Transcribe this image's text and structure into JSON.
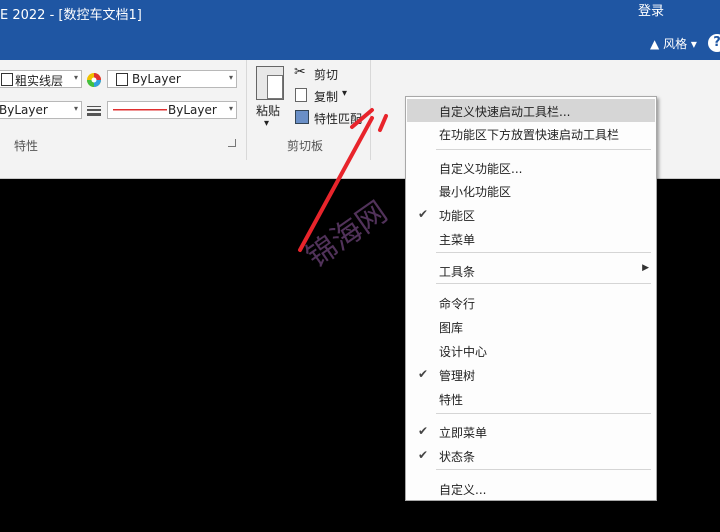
{
  "titlebar": {
    "title": "E 2022 - [数控车文档1]",
    "login": "登录"
  },
  "tabbar": {
    "style_label": "风格",
    "style_arrow": "▲",
    "dropdown_arrow": "▾",
    "help": "?"
  },
  "ribbon": {
    "layer_name": "粗实线层",
    "color_value": "ByLayer",
    "linetype_left": "ByLayer",
    "linetype_right": "ByLayer",
    "properties_label": "特性",
    "paste_label": "粘贴",
    "cut_label": "剪切",
    "copy_label": "复制",
    "match_label": "特性匹配",
    "clipboard_label": "剪切板"
  },
  "context_menu": {
    "items": [
      {
        "label": "自定义快速启动工具栏...",
        "checked": false,
        "highlighted": true
      },
      {
        "label": "在功能区下方放置快速启动工具栏",
        "checked": false
      },
      {
        "label": "自定义功能区...",
        "checked": false
      },
      {
        "label": "最小化功能区",
        "checked": false
      },
      {
        "label": "功能区",
        "checked": true,
        "check": "✔"
      },
      {
        "label": "主菜单",
        "checked": false
      },
      {
        "label": "工具条",
        "checked": false,
        "submenu": "▶"
      },
      {
        "label": "命令行",
        "checked": false
      },
      {
        "label": "图库",
        "checked": false
      },
      {
        "label": "设计中心",
        "checked": false
      },
      {
        "label": "管理树",
        "checked": true,
        "check": "✔"
      },
      {
        "label": "特性",
        "checked": false
      },
      {
        "label": "立即菜单",
        "checked": true,
        "check": "✔"
      },
      {
        "label": "状态条",
        "checked": true,
        "check": "✔"
      },
      {
        "label": "自定义...",
        "checked": false
      }
    ]
  },
  "watermark": "锦海网",
  "colors": {
    "title_bg": "#1f56a3",
    "ribbon_bg": "#f3f3f3",
    "canvas_bg": "#000000",
    "annotation": "#e8242b"
  }
}
